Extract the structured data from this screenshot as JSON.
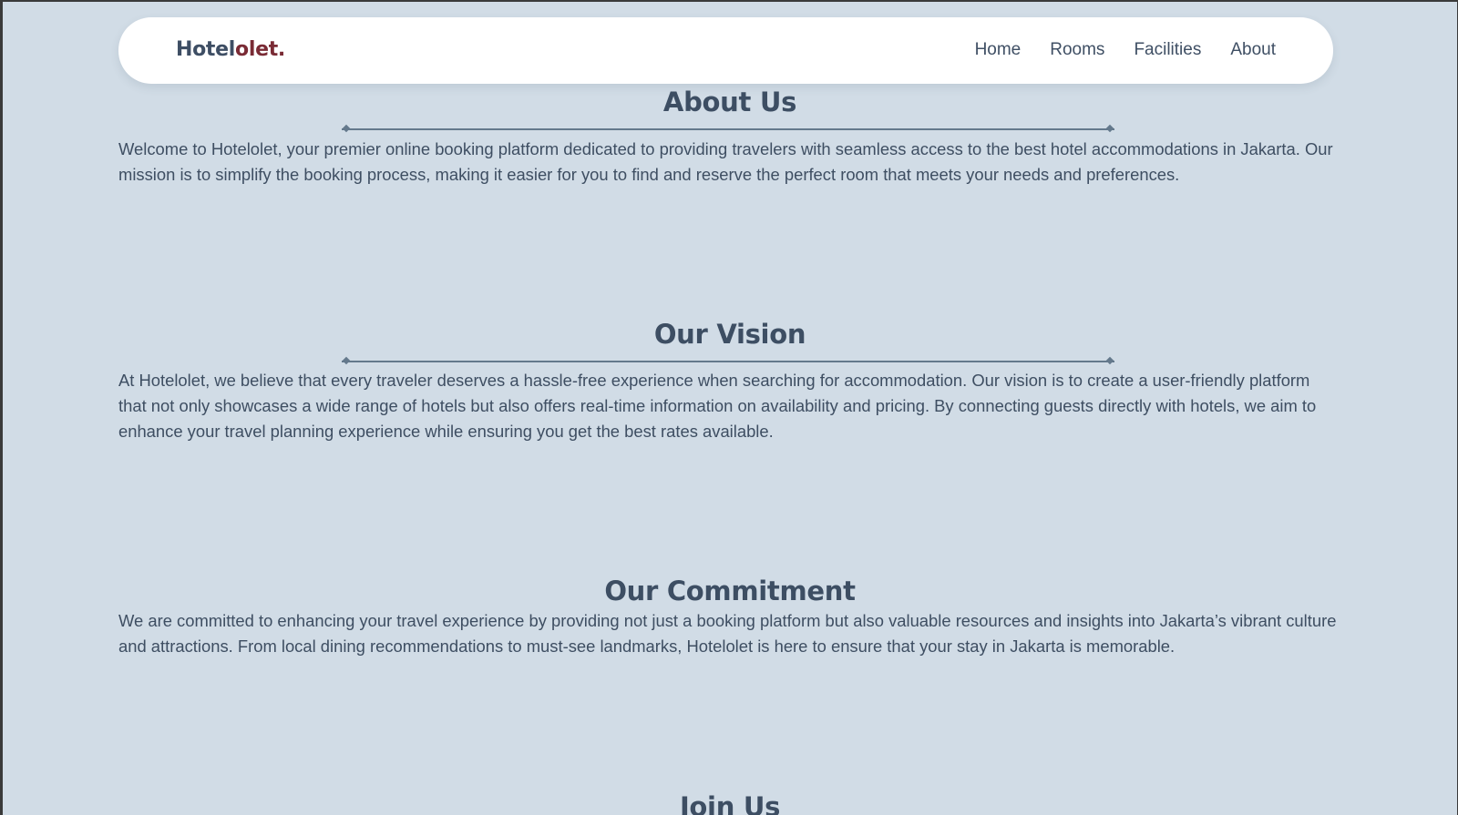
{
  "navbar": {
    "logo_part1": "Hotel",
    "logo_part2": "olet.",
    "links": [
      "Home",
      "Rooms",
      "Facilities",
      "About"
    ]
  },
  "sections": [
    {
      "title": "About Us",
      "text": "Welcome to Hotelolet, your premier online booking platform dedicated to providing travelers with seamless access to the best hotel accommodations in Jakarta. Our mission is to simplify the booking process, making it easier for you to find and reserve the perfect room that meets your needs and preferences."
    },
    {
      "title": "Our Vision",
      "text": "At Hotelolet, we believe that every traveler deserves a hassle-free experience when searching for accommodation. Our vision is to create a user-friendly platform that not only showcases a wide range of hotels but also offers real-time information on availability and pricing. By connecting guests directly with hotels, we aim to enhance your travel planning experience while ensuring you get the best rates available."
    },
    {
      "title": "Our Commitment",
      "text": "We are committed to enhancing your travel experience by providing not just a booking platform but also valuable resources and insights into Jakarta’s vibrant culture and attractions. From local dining recommendations to must-see landmarks, Hotelolet is here to ensure that your stay in Jakarta is memorable."
    },
    {
      "title": "Join Us"
    }
  ],
  "colors": {
    "page_background": "#d1dce6",
    "heading": "#3d4e63",
    "logo_accent": "#7a2b35",
    "divider": "#64798c"
  }
}
